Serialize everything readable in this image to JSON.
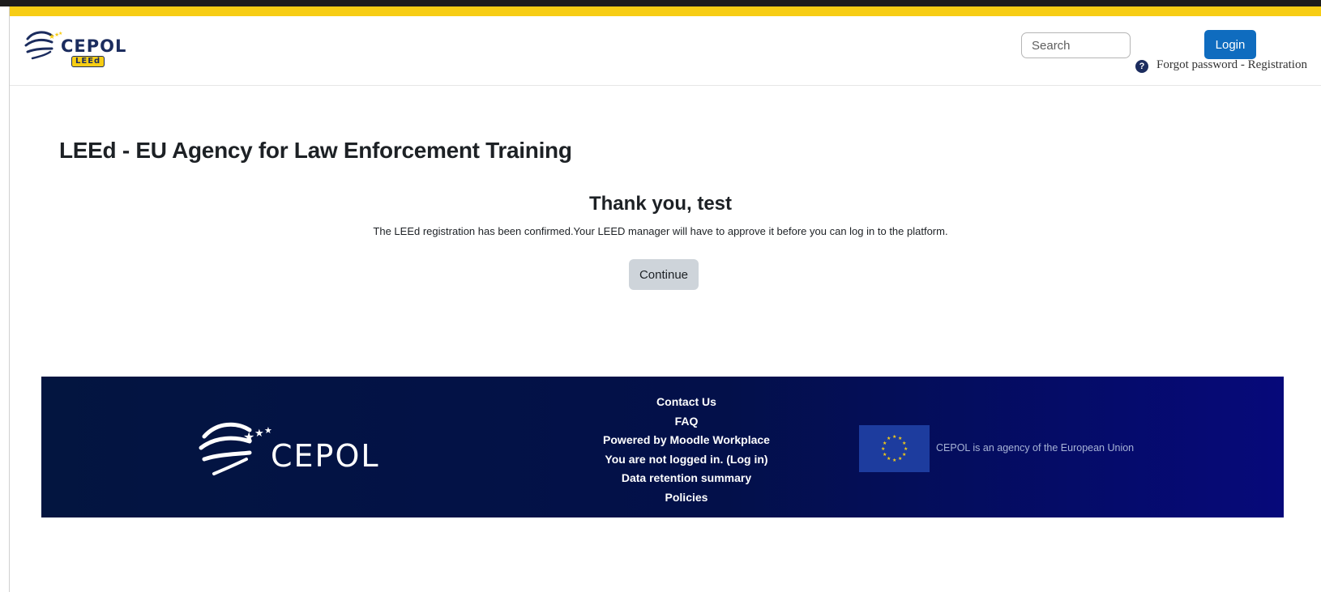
{
  "header": {
    "brand_name": "CEPOL",
    "brand_badge": "LEEd",
    "search": {
      "placeholder": "Search"
    },
    "login_label": "Login",
    "forgot_label": "Forgot password - Registration",
    "help_icon": "question-circle-icon"
  },
  "main": {
    "page_title": "LEEd - EU Agency for Law Enforcement Training",
    "heading": "Thank you, test",
    "message": "The LEEd registration has been confirmed.Your LEED manager will have to approve it before you can log in to the platform.",
    "continue_label": "Continue"
  },
  "footer": {
    "brand_name": "CEPOL",
    "links": [
      "Contact Us",
      "FAQ",
      "Powered by Moodle Workplace",
      "You are not logged in. (Log in)",
      "Data retention summary",
      "Policies"
    ],
    "eu_text": "CEPOL is an agency of the European Union"
  },
  "colors": {
    "accent_gold": "#f7cd14",
    "primary_blue": "#0f6cbf",
    "footer_navy": "#031540",
    "brand_navy": "#1b2c5e"
  }
}
